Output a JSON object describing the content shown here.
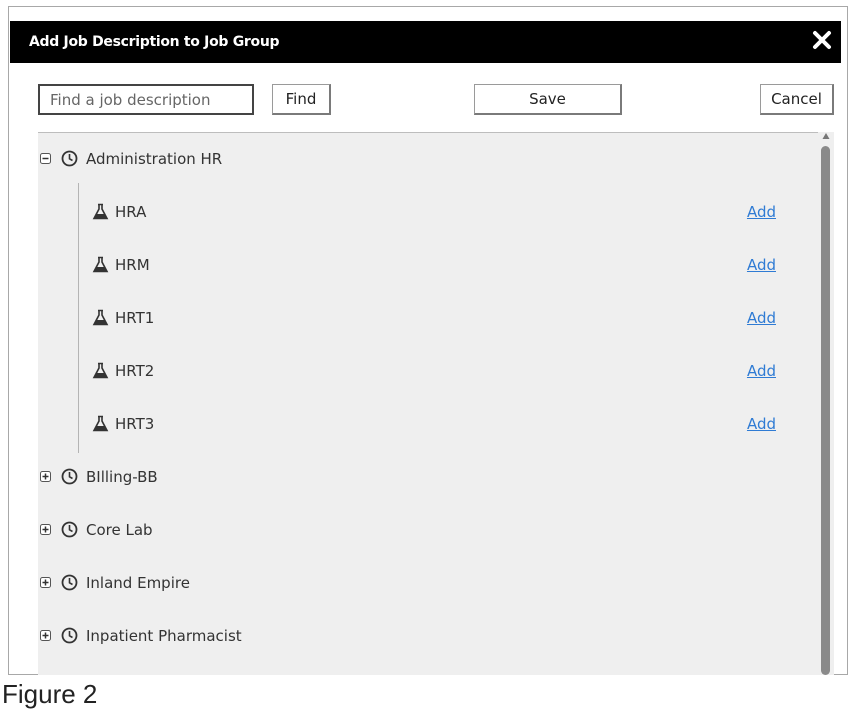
{
  "dialog": {
    "title": "Add Job Description to Job Group",
    "close_icon": "close-icon"
  },
  "toolbar": {
    "search_placeholder": "Find a job description",
    "search_value": "",
    "find_label": "Find",
    "save_label": "Save",
    "cancel_label": "Cancel"
  },
  "tree": {
    "groups": [
      {
        "label": "Administration HR",
        "expanded": true,
        "icon": "clock-icon",
        "children": [
          {
            "label": "HRA",
            "icon": "flask-icon",
            "action": "Add"
          },
          {
            "label": "HRM",
            "icon": "flask-icon",
            "action": "Add"
          },
          {
            "label": "HRT1",
            "icon": "flask-icon",
            "action": "Add"
          },
          {
            "label": "HRT2",
            "icon": "flask-icon",
            "action": "Add"
          },
          {
            "label": "HRT3",
            "icon": "flask-icon",
            "action": "Add"
          }
        ]
      },
      {
        "label": "BIlling-BB",
        "expanded": false,
        "icon": "clock-icon"
      },
      {
        "label": "Core Lab",
        "expanded": false,
        "icon": "clock-icon"
      },
      {
        "label": "Inland Empire",
        "expanded": false,
        "icon": "clock-icon"
      },
      {
        "label": "Inpatient Pharmacist",
        "expanded": false,
        "icon": "clock-icon"
      }
    ]
  },
  "colors": {
    "titlebar": "#000000",
    "panel": "#efefef",
    "link": "#2f7bd4"
  },
  "caption": "Figure 2"
}
